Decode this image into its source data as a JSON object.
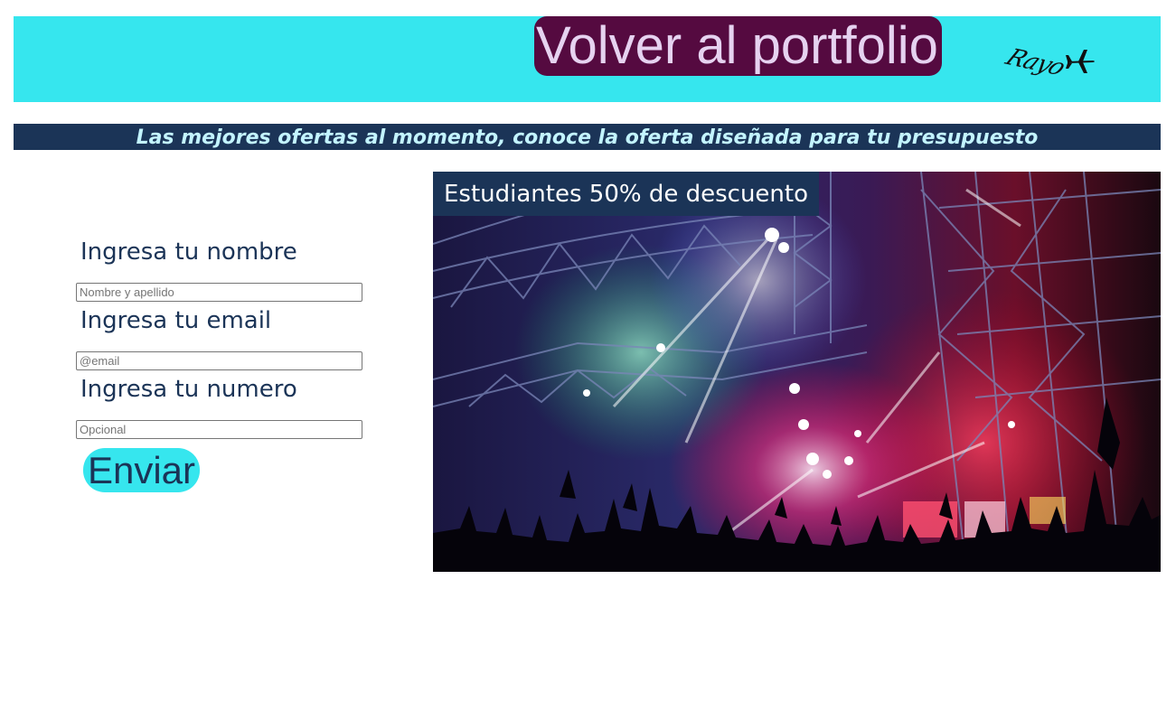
{
  "header": {
    "back_button_label": "Volver al portfolio",
    "logo_text": "Rayo",
    "logo_icon": "airplane-icon",
    "background_color": "#36e6ee",
    "button_color": "#550a40"
  },
  "banner": {
    "text": "Las mejores ofertas al momento, conoce la oferta diseñada para tu presupuesto",
    "background_color": "#1b3457"
  },
  "form": {
    "name_label": "Ingresa tu nombre",
    "name_placeholder": "Nombre y apellido",
    "name_value": "",
    "email_label": "Ingresa tu email",
    "email_placeholder": "@email",
    "email_value": "",
    "phone_label": "Ingresa tu numero",
    "phone_placeholder": "Opcional",
    "phone_value": "",
    "submit_label": "Enviar"
  },
  "promo": {
    "caption": "Estudiantes 50% de descuento",
    "image_description_icon": "concert-image"
  }
}
